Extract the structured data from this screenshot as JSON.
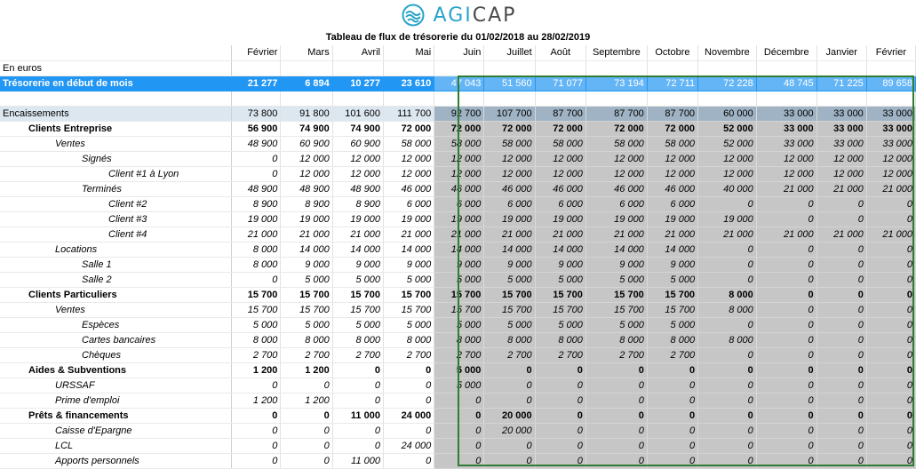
{
  "brand": {
    "logo_text_a": "AGI",
    "logo_text_b": "CAP",
    "accent": "#29a3c9"
  },
  "title": "Tableau de flux de trésorerie du 01/02/2018 au 28/02/2019",
  "months": [
    "Février",
    "Mars",
    "Avril",
    "Mai",
    "Juin",
    "Juillet",
    "Août",
    "Septembre",
    "Octobre",
    "Novembre",
    "Décembre",
    "Janvier",
    "Février"
  ],
  "unit_label": "En euros",
  "rows": [
    {
      "label": "Trésorerie en début de mois",
      "style": "tres",
      "indent": 0,
      "values": [
        "21 277",
        "6 894",
        "10 277",
        "23 610",
        "47 043",
        "51 560",
        "71 077",
        "73 194",
        "72 711",
        "72 228",
        "48 745",
        "71 225",
        "89 658"
      ]
    },
    {
      "label": "",
      "style": "blank",
      "indent": 0,
      "values": [
        "",
        "",
        "",
        "",
        "",
        "",
        "",
        "",
        "",
        "",
        "",
        "",
        ""
      ]
    },
    {
      "label": "Encaissements",
      "style": "enc",
      "indent": 0,
      "values": [
        "73 800",
        "91 800",
        "101 600",
        "111 700",
        "92 700",
        "107 700",
        "87 700",
        "87 700",
        "87 700",
        "60 000",
        "33 000",
        "33 000",
        "33 000"
      ]
    },
    {
      "label": "Clients Entreprise",
      "style": "b",
      "indent": 1,
      "values": [
        "56 900",
        "74 900",
        "74 900",
        "72 000",
        "72 000",
        "72 000",
        "72 000",
        "72 000",
        "72 000",
        "52 000",
        "33 000",
        "33 000",
        "33 000"
      ]
    },
    {
      "label": "Ventes",
      "style": "i",
      "indent": 2,
      "values": [
        "48 900",
        "60 900",
        "60 900",
        "58 000",
        "58 000",
        "58 000",
        "58 000",
        "58 000",
        "58 000",
        "52 000",
        "33 000",
        "33 000",
        "33 000"
      ]
    },
    {
      "label": "Signés",
      "style": "i",
      "indent": 3,
      "values": [
        "0",
        "12 000",
        "12 000",
        "12 000",
        "12 000",
        "12 000",
        "12 000",
        "12 000",
        "12 000",
        "12 000",
        "12 000",
        "12 000",
        "12 000"
      ]
    },
    {
      "label": "Client #1 à Lyon",
      "style": "i",
      "indent": 4,
      "values": [
        "0",
        "12 000",
        "12 000",
        "12 000",
        "12 000",
        "12 000",
        "12 000",
        "12 000",
        "12 000",
        "12 000",
        "12 000",
        "12 000",
        "12 000"
      ]
    },
    {
      "label": "Terminés",
      "style": "i",
      "indent": 3,
      "values": [
        "48 900",
        "48 900",
        "48 900",
        "46 000",
        "46 000",
        "46 000",
        "46 000",
        "46 000",
        "46 000",
        "40 000",
        "21 000",
        "21 000",
        "21 000"
      ]
    },
    {
      "label": "Client #2",
      "style": "i",
      "indent": 4,
      "values": [
        "8 900",
        "8 900",
        "8 900",
        "6 000",
        "6 000",
        "6 000",
        "6 000",
        "6 000",
        "6 000",
        "0",
        "0",
        "0",
        "0"
      ]
    },
    {
      "label": "Client #3",
      "style": "i",
      "indent": 4,
      "values": [
        "19 000",
        "19 000",
        "19 000",
        "19 000",
        "19 000",
        "19 000",
        "19 000",
        "19 000",
        "19 000",
        "19 000",
        "0",
        "0",
        "0"
      ]
    },
    {
      "label": "Client #4",
      "style": "i",
      "indent": 4,
      "values": [
        "21 000",
        "21 000",
        "21 000",
        "21 000",
        "21 000",
        "21 000",
        "21 000",
        "21 000",
        "21 000",
        "21 000",
        "21 000",
        "21 000",
        "21 000"
      ]
    },
    {
      "label": "Locations",
      "style": "i",
      "indent": 2,
      "values": [
        "8 000",
        "14 000",
        "14 000",
        "14 000",
        "14 000",
        "14 000",
        "14 000",
        "14 000",
        "14 000",
        "0",
        "0",
        "0",
        "0"
      ]
    },
    {
      "label": "Salle 1",
      "style": "i",
      "indent": 3,
      "values": [
        "8 000",
        "9 000",
        "9 000",
        "9 000",
        "9 000",
        "9 000",
        "9 000",
        "9 000",
        "9 000",
        "0",
        "0",
        "0",
        "0"
      ]
    },
    {
      "label": "Salle 2",
      "style": "i",
      "indent": 3,
      "values": [
        "0",
        "5 000",
        "5 000",
        "5 000",
        "5 000",
        "5 000",
        "5 000",
        "5 000",
        "5 000",
        "0",
        "0",
        "0",
        "0"
      ]
    },
    {
      "label": "Clients Particuliers",
      "style": "b",
      "indent": 1,
      "values": [
        "15 700",
        "15 700",
        "15 700",
        "15 700",
        "15 700",
        "15 700",
        "15 700",
        "15 700",
        "15 700",
        "8 000",
        "0",
        "0",
        "0"
      ]
    },
    {
      "label": "Ventes",
      "style": "i",
      "indent": 2,
      "values": [
        "15 700",
        "15 700",
        "15 700",
        "15 700",
        "15 700",
        "15 700",
        "15 700",
        "15 700",
        "15 700",
        "8 000",
        "0",
        "0",
        "0"
      ]
    },
    {
      "label": "Espèces",
      "style": "i",
      "indent": 3,
      "values": [
        "5 000",
        "5 000",
        "5 000",
        "5 000",
        "5 000",
        "5 000",
        "5 000",
        "5 000",
        "5 000",
        "0",
        "0",
        "0",
        "0"
      ]
    },
    {
      "label": "Cartes bancaires",
      "style": "i",
      "indent": 3,
      "values": [
        "8 000",
        "8 000",
        "8 000",
        "8 000",
        "8 000",
        "8 000",
        "8 000",
        "8 000",
        "8 000",
        "8 000",
        "0",
        "0",
        "0"
      ]
    },
    {
      "label": "Chèques",
      "style": "i",
      "indent": 3,
      "values": [
        "2 700",
        "2 700",
        "2 700",
        "2 700",
        "2 700",
        "2 700",
        "2 700",
        "2 700",
        "2 700",
        "0",
        "0",
        "0",
        "0"
      ]
    },
    {
      "label": "Aides & Subventions",
      "style": "b",
      "indent": 1,
      "values": [
        "1 200",
        "1 200",
        "0",
        "0",
        "5 000",
        "0",
        "0",
        "0",
        "0",
        "0",
        "0",
        "0",
        "0"
      ]
    },
    {
      "label": "URSSAF",
      "style": "i",
      "indent": 2,
      "values": [
        "0",
        "0",
        "0",
        "0",
        "5 000",
        "0",
        "0",
        "0",
        "0",
        "0",
        "0",
        "0",
        "0"
      ]
    },
    {
      "label": "Prime d'emploi",
      "style": "i",
      "indent": 2,
      "values": [
        "1 200",
        "1 200",
        "0",
        "0",
        "0",
        "0",
        "0",
        "0",
        "0",
        "0",
        "0",
        "0",
        "0"
      ]
    },
    {
      "label": "Prêts & financements",
      "style": "b",
      "indent": 1,
      "values": [
        "0",
        "0",
        "11 000",
        "24 000",
        "0",
        "20 000",
        "0",
        "0",
        "0",
        "0",
        "0",
        "0",
        "0"
      ]
    },
    {
      "label": "Caisse d'Epargne",
      "style": "i",
      "indent": 2,
      "values": [
        "0",
        "0",
        "0",
        "0",
        "0",
        "20 000",
        "0",
        "0",
        "0",
        "0",
        "0",
        "0",
        "0"
      ]
    },
    {
      "label": "LCL",
      "style": "i",
      "indent": 2,
      "values": [
        "0",
        "0",
        "0",
        "24 000",
        "0",
        "0",
        "0",
        "0",
        "0",
        "0",
        "0",
        "0",
        "0"
      ]
    },
    {
      "label": "Apports personnels",
      "style": "i",
      "indent": 2,
      "values": [
        "0",
        "0",
        "11 000",
        "0",
        "0",
        "0",
        "0",
        "0",
        "0",
        "0",
        "0",
        "0",
        "0"
      ]
    }
  ]
}
